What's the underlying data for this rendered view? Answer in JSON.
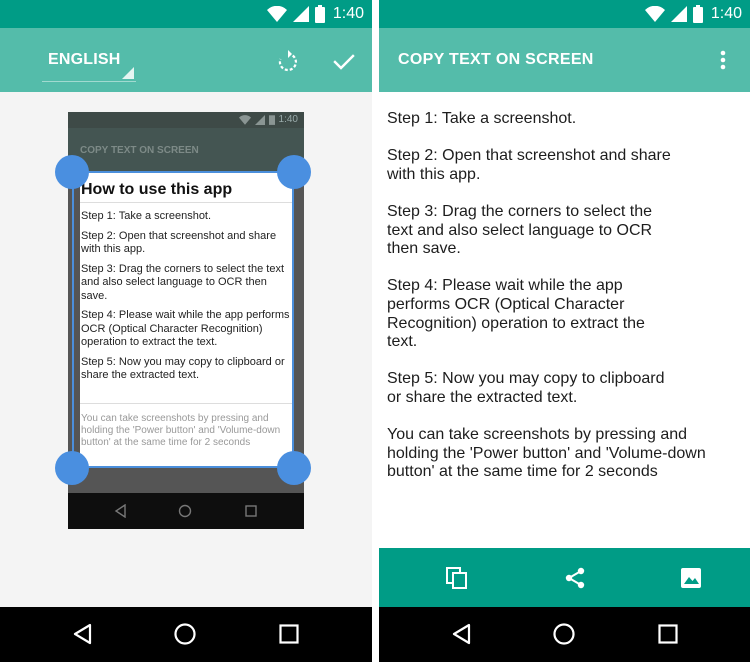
{
  "status_bar": {
    "time": "1:40"
  },
  "left_screen": {
    "language": "ENGLISH",
    "preview": {
      "status_time": "1:40",
      "app_title": "COPY TEXT ON SCREEN",
      "dialog_title": "How to use this app",
      "steps": [
        "Step 1: Take a screenshot.",
        "Step 2: Open that screenshot and share with this app.",
        "Step 3: Drag the corners to select the text and also select language to OCR then save.",
        "Step 4: Please wait while the app performs  OCR (Optical Character Recognition) operation to extract the text.",
        "Step 5: Now you may copy to clipboard or share the extracted text."
      ],
      "note": "You can take screenshots by pressing and holding the 'Power button' and 'Volume-down button' at the same time for 2 seconds"
    }
  },
  "right_screen": {
    "title": "COPY TEXT ON SCREEN",
    "paragraphs": [
      [
        "Step 1: Take a screenshot."
      ],
      [
        "Step 2: Open that screenshot and share",
        "with this app."
      ],
      [
        "Step 3: Drag the corners to select the",
        "text and also select language to OCR",
        "then save."
      ],
      [
        "Step 4: Please wait while the app",
        "performs OCR (Optical Character",
        "Recognition) operation to extract the",
        "text."
      ],
      [
        "Step 5: Now you may copy to clipboard",
        "or share the extracted text."
      ],
      [
        "You can take screenshots by pressing and",
        "holding the 'Power button' and 'Volume-down",
        "button' at the same time for 2 seconds"
      ]
    ],
    "actions": [
      "copy-icon",
      "share-icon",
      "image-icon"
    ]
  },
  "nav_icons": [
    "back-icon",
    "home-icon",
    "recents-icon"
  ],
  "colors": {
    "status_bar": "#009c86",
    "app_bar": "#54bcaa",
    "handle": "#4a8fe0",
    "action_bar": "#009c86"
  }
}
